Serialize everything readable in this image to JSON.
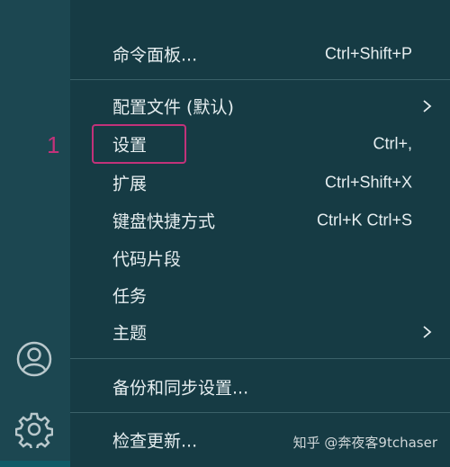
{
  "menu": {
    "command_palette": {
      "label": "命令面板...",
      "shortcut": "Ctrl+Shift+P"
    },
    "profile": {
      "label": "配置文件 (默认)",
      "has_submenu": true
    },
    "settings": {
      "label": "设置",
      "shortcut": "Ctrl+,"
    },
    "extensions": {
      "label": "扩展",
      "shortcut": "Ctrl+Shift+X"
    },
    "keyboard_shortcuts": {
      "label": "键盘快捷方式",
      "shortcut": "Ctrl+K Ctrl+S"
    },
    "snippets": {
      "label": "代码片段"
    },
    "tasks": {
      "label": "任务"
    },
    "themes": {
      "label": "主题",
      "has_submenu": true
    },
    "backup_sync": {
      "label": "备份和同步设置..."
    },
    "check_updates": {
      "label": "检查更新..."
    }
  },
  "annotation": {
    "step_number": "1",
    "color": "#c2327a"
  },
  "activity_bar": {
    "icons": [
      "account-icon",
      "manage-gear-icon"
    ]
  },
  "watermark": "知乎 @奔夜客9tchaser",
  "colors": {
    "menu_bg": "#163b44",
    "activity_bar_bg": "#1c4751",
    "text": "#e6eef0",
    "separator": "#3b6169"
  }
}
